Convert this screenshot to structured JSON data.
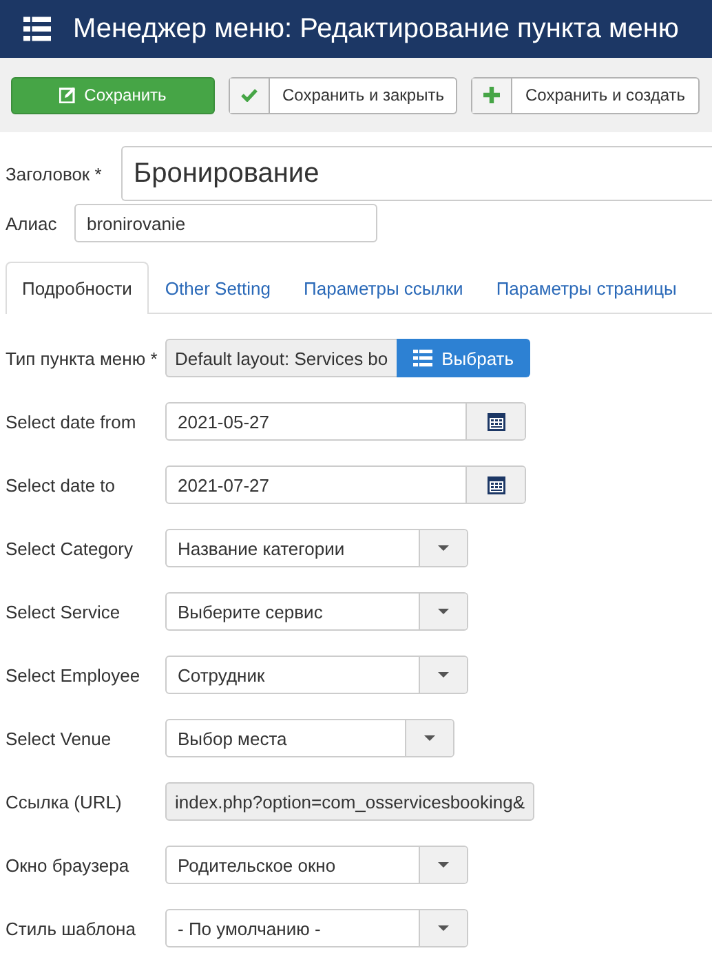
{
  "header": {
    "title": "Менеджер меню: Редактирование пункта меню"
  },
  "toolbar": [
    {
      "kind": "primary",
      "label": "Сохранить"
    },
    {
      "kind": "check",
      "label": "Сохранить и закрыть"
    },
    {
      "kind": "plus",
      "label": "Сохранить и создать"
    }
  ],
  "title_field": {
    "label": "Заголовок *",
    "value": "Бронирование"
  },
  "alias_field": {
    "label": "Алиас",
    "value": "bronirovanie"
  },
  "tabs": [
    {
      "label": "Подробности",
      "selected": true
    },
    {
      "label": "Other Setting",
      "selected": false
    },
    {
      "label": "Параметры ссылки",
      "selected": false
    },
    {
      "label": "Параметры страницы",
      "selected": false
    }
  ],
  "fields": [
    {
      "kind": "type",
      "label": "Тип пункта меню *",
      "value": "Default layout: Services bo",
      "button": "Выбрать"
    },
    {
      "kind": "date",
      "label": "Select date from",
      "value": "2021-05-27"
    },
    {
      "kind": "date",
      "label": "Select date to",
      "value": "2021-07-27"
    },
    {
      "kind": "select",
      "label": "Select Category",
      "value": "Название категории"
    },
    {
      "kind": "select",
      "label": "Select Service",
      "value": "Выберите сервис"
    },
    {
      "kind": "select",
      "label": "Select Employee",
      "value": "Сотрудник"
    },
    {
      "kind": "select_narrow",
      "label": "Select Venue",
      "value": "Выбор места"
    },
    {
      "kind": "readonly",
      "label": "Ссылка (URL)",
      "value": "index.php?option=com_osservicesbooking&"
    },
    {
      "kind": "select",
      "label": "Окно браузера",
      "value": "Родительское окно"
    },
    {
      "kind": "select",
      "label": "Стиль шаблона",
      "value": "- По умолчанию -"
    }
  ]
}
